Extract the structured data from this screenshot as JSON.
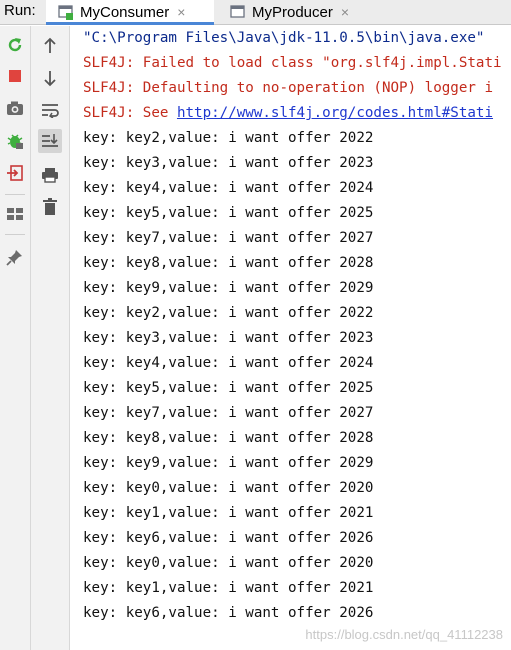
{
  "header": {
    "run_label": "Run:",
    "tabs": [
      {
        "label": "MyConsumer",
        "active": true,
        "close": "×"
      },
      {
        "label": "MyProducer",
        "active": false,
        "close": "×"
      }
    ]
  },
  "toolbar_left": {
    "icons": [
      "rerun-icon",
      "stop-icon",
      "camera-icon",
      "debug-icon",
      "exit-icon",
      "layout-icon",
      "pin-icon"
    ]
  },
  "toolbar_right": {
    "icons": [
      "up-arrow-icon",
      "down-arrow-icon",
      "soft-wrap-icon",
      "scroll-to-end-icon",
      "print-icon",
      "trash-icon"
    ]
  },
  "console": {
    "command": "\"C:\\Program Files\\Java\\jdk-11.0.5\\bin\\java.exe\"",
    "slf4j_1": "SLF4J: Failed to load class \"org.slf4j.impl.Stati",
    "slf4j_2": "SLF4J: Defaulting to no-operation (NOP) logger i",
    "slf4j_3_prefix": "SLF4J: See ",
    "slf4j_3_link": "http://www.slf4j.org/codes.html#Stati",
    "output_lines": [
      "key: key2,value: i want offer 2022",
      "key: key3,value: i want offer 2023",
      "key: key4,value: i want offer 2024",
      "key: key5,value: i want offer 2025",
      "key: key7,value: i want offer 2027",
      "key: key8,value: i want offer 2028",
      "key: key9,value: i want offer 2029",
      "key: key2,value: i want offer 2022",
      "key: key3,value: i want offer 2023",
      "key: key4,value: i want offer 2024",
      "key: key5,value: i want offer 2025",
      "key: key7,value: i want offer 2027",
      "key: key8,value: i want offer 2028",
      "key: key9,value: i want offer 2029",
      "key: key0,value: i want offer 2020",
      "key: key1,value: i want offer 2021",
      "key: key6,value: i want offer 2026",
      "key: key0,value: i want offer 2020",
      "key: key1,value: i want offer 2021",
      "key: key6,value: i want offer 2026"
    ],
    "watermark": "https://blog.csdn.net/qq_41112238"
  },
  "colors": {
    "accent": "#4a86d6",
    "system_text": "#0c2a8c",
    "error_text": "#c32b1c",
    "link": "#1f38cf"
  }
}
